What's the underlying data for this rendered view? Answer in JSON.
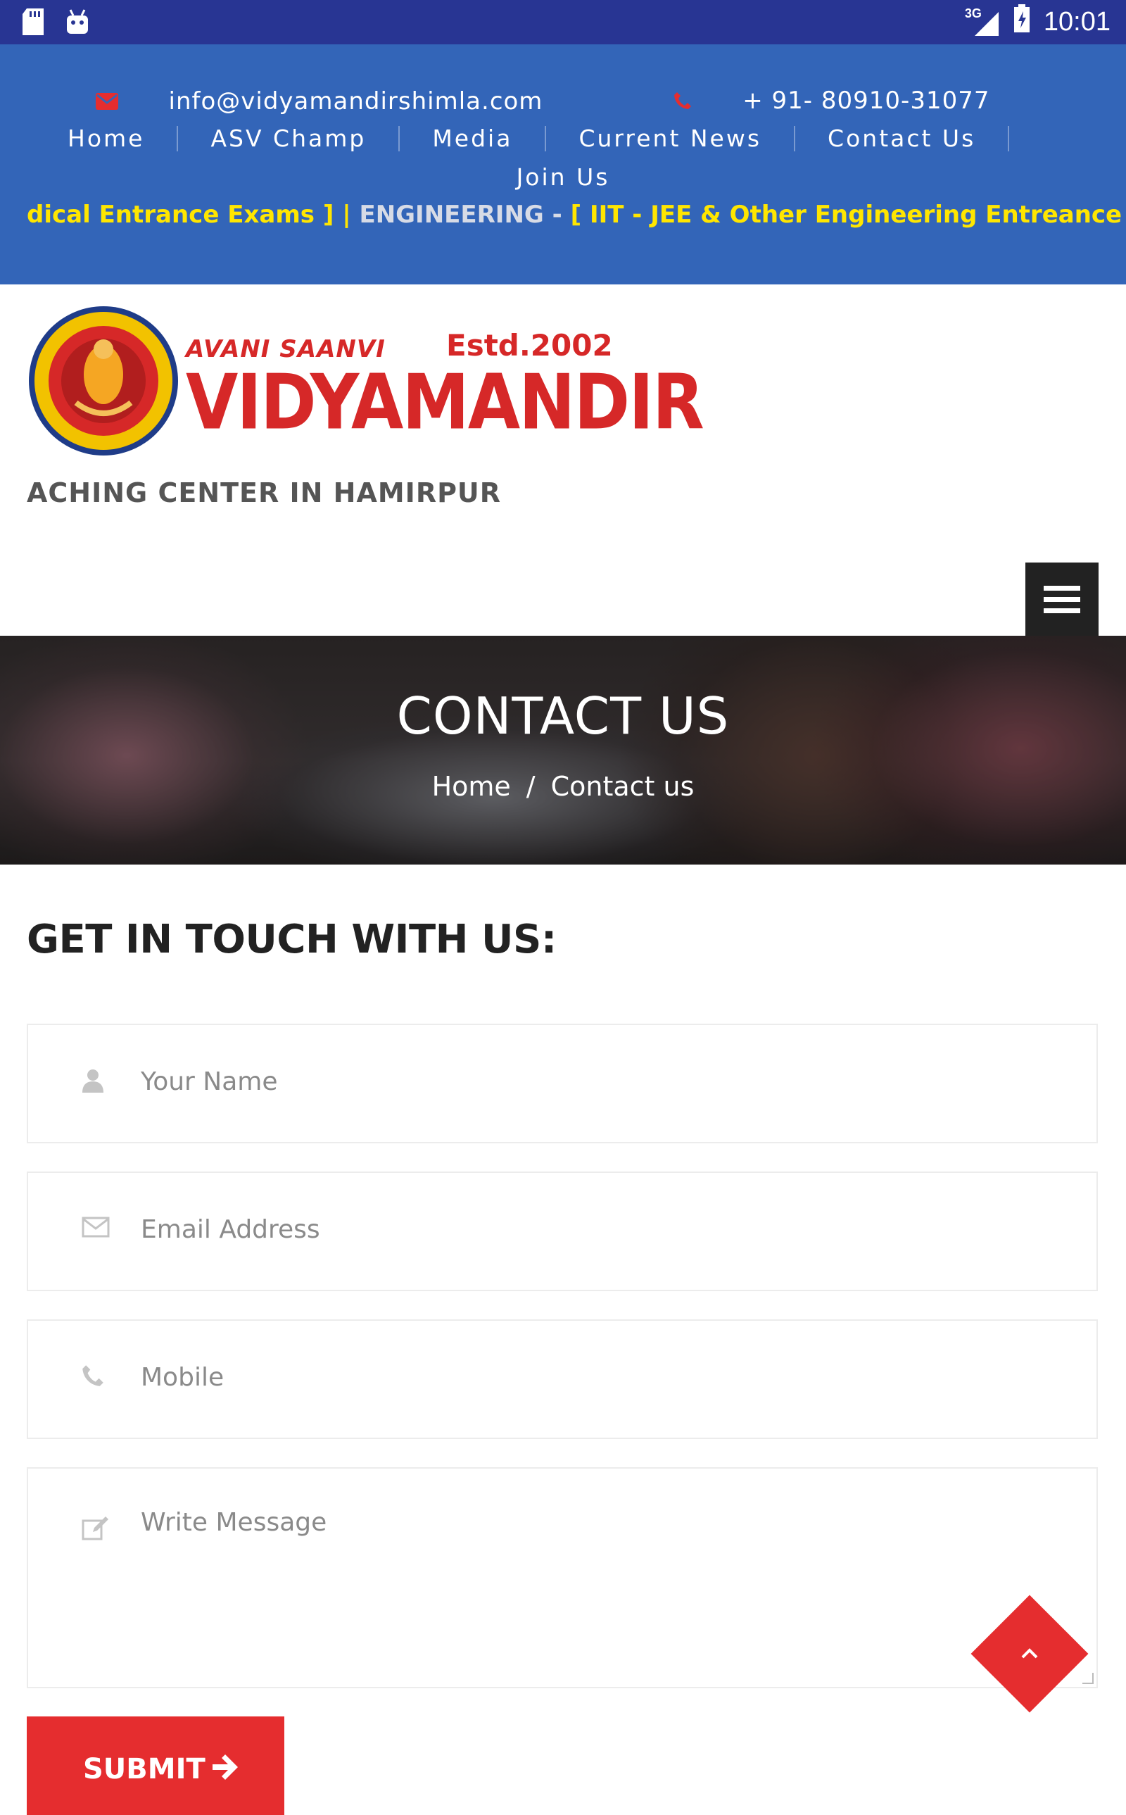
{
  "status_bar": {
    "network": "3G",
    "time": "10:01"
  },
  "topbar": {
    "email": "info@vidyamandirshimla.com",
    "phone": "+ 91- 80910-31077",
    "nav": [
      "Home",
      "ASV Champ",
      "Media",
      "Current News",
      "Contact Us"
    ],
    "nav_row2": "Join Us",
    "marquee_yellow_1": "dical Entrance Exams ] | ",
    "marquee_muted": "ENGINEERING - ",
    "marquee_yellow_2": "[ IIT - JEE & Other Engineering Entreance Exams ]"
  },
  "logo": {
    "small": "AVANI SAANVI",
    "estd": "Estd.2002",
    "big": "VIDYAMANDIR",
    "tagline": "ACHING CENTER IN HAMIRPUR"
  },
  "banner": {
    "title": "CONTACT US",
    "breadcrumb_home": "Home",
    "breadcrumb_sep": "/",
    "breadcrumb_current": "Contact us"
  },
  "form": {
    "title": "GET IN TOUCH WITH US:",
    "name_placeholder": "Your Name",
    "email_placeholder": "Email Address",
    "mobile_placeholder": "Mobile",
    "message_placeholder": "Write Message",
    "submit_label": "SUBMIT"
  },
  "colors": {
    "status_bar": "#283593",
    "topbar": "#3365b8",
    "accent_red": "#e52d2f",
    "marquee_yellow": "#ffe600"
  },
  "icons": [
    "sd-card-icon",
    "android-icon",
    "signal-icon",
    "battery-icon",
    "envelope-icon",
    "phone-icon",
    "menu-icon",
    "user-icon",
    "edit-icon",
    "arrow-right-icon",
    "chevron-up-icon"
  ]
}
